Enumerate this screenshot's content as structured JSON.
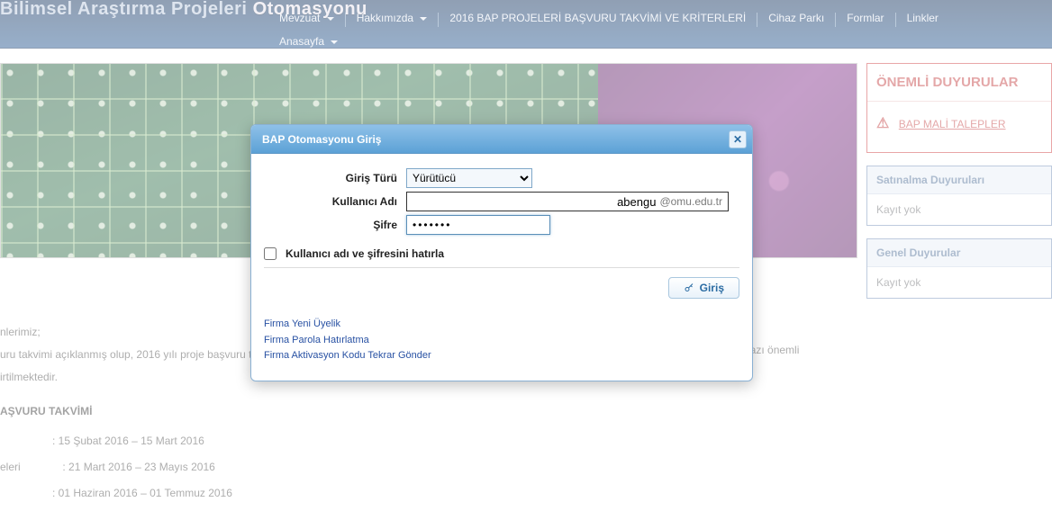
{
  "header": {
    "site_title_a": "Bilimsel Araştırma Projeleri",
    "site_title_b": "Otomasyonu"
  },
  "nav": {
    "items": [
      {
        "label": "Mevzuat",
        "dropdown": true
      },
      {
        "label": "Hakkımızda",
        "dropdown": true
      },
      {
        "label": "2016 BAP PROJELERİ BAŞVURU TAKVİMİ VE KRİTERLERİ",
        "dropdown": false
      },
      {
        "label": "Cihaz Parkı",
        "dropdown": false
      },
      {
        "label": "Formlar",
        "dropdown": false
      },
      {
        "label": "Linkler",
        "dropdown": false
      },
      {
        "label": "Anasayfa",
        "dropdown": true
      }
    ]
  },
  "sidebar": {
    "important": {
      "title": "ÖNEMLİ DUYURULAR",
      "link_label": "BAP MALİ TALEPLER"
    },
    "purchase": {
      "title": "Satınalma Duyuruları",
      "empty": "Kayıt yok"
    },
    "general": {
      "title": "Genel Duyurular",
      "empty": "Kayıt yok"
    }
  },
  "content": {
    "line1": "nlerimiz;",
    "line2_left": "uru takvimi açıklanmış olup, 2016 yılı proje başvuru ta",
    "line2_right": "bazı önemli",
    "line3": "irtilmektedir.",
    "heading": "AŞVURU TAKVİMİ",
    "row1": ": 15 Şubat 2016 – 15 Mart 2016",
    "row2_label": "eleri",
    "row2_value": ": 21 Mart 2016  –  23 Mayıs 2016",
    "row3": ": 01 Haziran 2016 – 01 Temmuz 2016"
  },
  "dialog": {
    "title": "BAP Otomasyonu Giriş",
    "labels": {
      "login_type": "Giriş Türü",
      "username": "Kullanıcı Adı",
      "password": "Şifre",
      "remember": "Kullanıcı adı ve şifresini hatırla",
      "submit": "Giriş"
    },
    "login_type_options": [
      "Yürütücü"
    ],
    "login_type_selected": "Yürütücü",
    "username_value": "abengu",
    "username_suffix": "@omu.edu.tr",
    "password_value": "•••••••",
    "links": {
      "signup": "Firma Yeni Üyelik",
      "forgot": "Firma Parola Hatırlatma",
      "resend": "Firma Aktivasyon Kodu Tekrar Gönder"
    }
  }
}
